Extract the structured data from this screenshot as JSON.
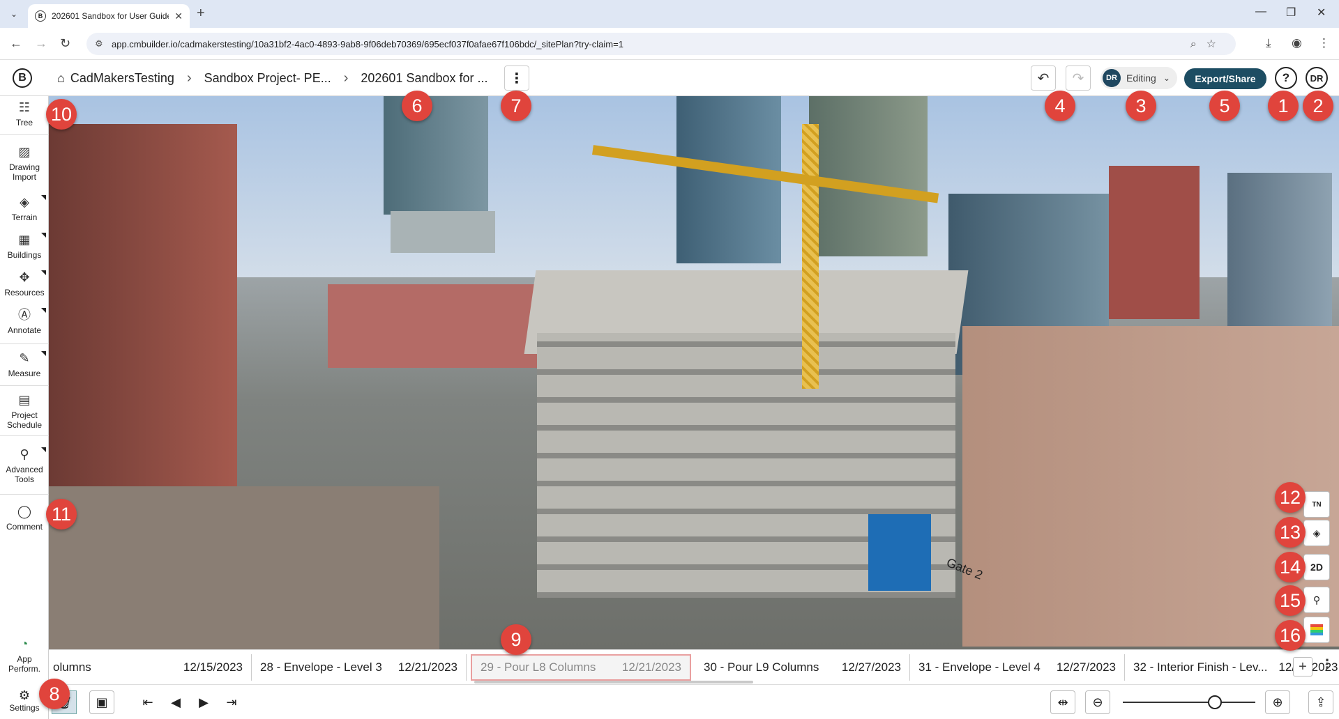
{
  "browser": {
    "tab_title": "202601 Sandbox for User Guide",
    "url": "app.cmbuilder.io/cadmakerstesting/10a31bf2-4ac0-4893-9ab8-9f06deb70369/695ecf037f0afae67f106bdc/_sitePlan?try-claim=1"
  },
  "header": {
    "breadcrumb": [
      "CadMakersTesting",
      "Sandbox Project- PE...",
      "202601 Sandbox for ..."
    ],
    "editing_avatar": "DR",
    "editing_label": "Editing",
    "export_label": "Export/Share",
    "help_label": "?",
    "user_initials": "DR",
    "logo_letter": "B"
  },
  "left_tools": [
    {
      "label": "Tree",
      "icon": "tree-icon"
    },
    {
      "label": "Drawing Import",
      "icon": "image-icon"
    },
    {
      "label": "Terrain",
      "icon": "terrain-icon"
    },
    {
      "label": "Buildings",
      "icon": "buildings-icon"
    },
    {
      "label": "Resources",
      "icon": "resources-icon"
    },
    {
      "label": "Annotate",
      "icon": "annotate-icon"
    },
    {
      "label": "Measure",
      "icon": "measure-icon"
    },
    {
      "label": "Project Schedule",
      "icon": "schedule-icon"
    },
    {
      "label": "Advanced Tools",
      "icon": "advanced-tools-icon"
    },
    {
      "label": "Comment",
      "icon": "comment-icon"
    },
    {
      "label": "App Perform.",
      "icon": "performance-icon"
    },
    {
      "label": "Settings",
      "icon": "gear-icon"
    }
  ],
  "view_tools": [
    {
      "label": "TN",
      "icon": "north-arrow-icon"
    },
    {
      "label": "",
      "icon": "layers-icon"
    },
    {
      "label": "2D",
      "icon": "2d-icon"
    },
    {
      "label": "",
      "icon": "crane-icon"
    },
    {
      "label": "",
      "icon": "color-legend-icon"
    }
  ],
  "timeline": {
    "tasks": [
      {
        "name": "olumns",
        "date": "12/15/2023"
      },
      {
        "name": "28 - Envelope - Level 3",
        "date": "12/21/2023"
      },
      {
        "name": "29 - Pour L8 Columns",
        "date": "12/21/2023",
        "current": true
      },
      {
        "name": "30 - Pour L9 Columns",
        "date": "12/27/2023"
      },
      {
        "name": "31 - Envelope - Level 4",
        "date": "12/27/2023"
      },
      {
        "name": "32 - Interior Finish - Lev...",
        "date": "12/29/2023"
      }
    ]
  },
  "scene": {
    "gate_label": "Gate 2"
  },
  "badges": [
    "1",
    "2",
    "3",
    "4",
    "5",
    "6",
    "7",
    "8",
    "9",
    "10",
    "11",
    "12",
    "13",
    "14",
    "15",
    "16"
  ],
  "colors": {
    "accent": "#1d4d63",
    "badge": "#e0443c"
  }
}
